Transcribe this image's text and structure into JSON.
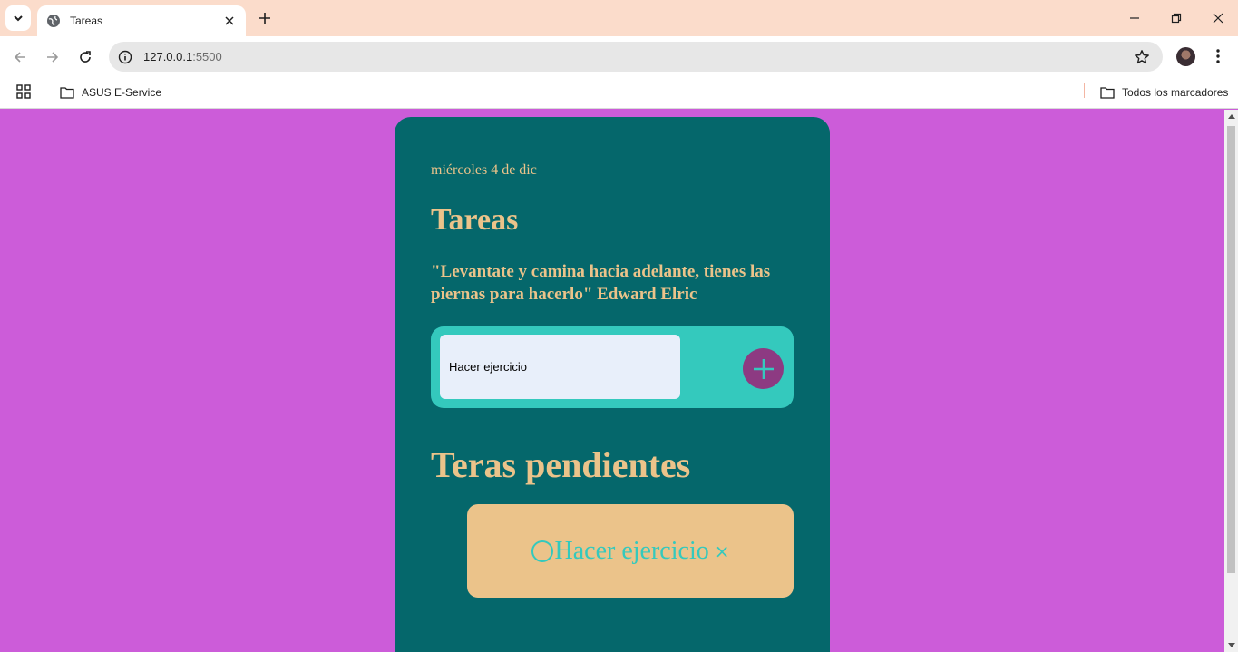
{
  "browser": {
    "tab_title": "Tareas",
    "url_host": "127.0.0.1",
    "url_port": ":5500",
    "bookmarks": [
      {
        "label": "ASUS E-Service"
      }
    ],
    "all_bookmarks_label": "Todos los marcadores"
  },
  "app": {
    "date": "miércoles 4 de dic",
    "title": "Tareas",
    "quote": "\"Levantate y camina hacia adelante, tienes las piernas para hacerlo\" Edward Elric",
    "input_value": "Hacer ejercicio",
    "pending_title": "Teras pendientes",
    "tasks": [
      {
        "text": "Hacer ejercicio"
      }
    ],
    "delete_symbol": "×"
  },
  "colors": {
    "page_bg": "#cc5cd9",
    "card_bg": "#05676b",
    "accent_text": "#ebc38a",
    "panel_teal": "#34c9bd",
    "add_button": "#8d3a82"
  }
}
